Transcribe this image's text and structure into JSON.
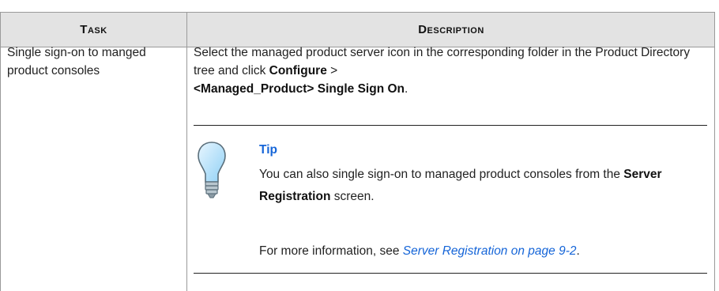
{
  "table": {
    "headers": {
      "task": "Task",
      "description": "Description"
    },
    "row": {
      "task": "Single sign-on to manged product consoles",
      "description": {
        "prefix": "Select the managed product server icon in the corresponding folder in the Product Directory tree and click ",
        "configure": "Configure",
        "separator": " > ",
        "menu_item": "<Managed_Product> Single Sign On",
        "suffix": "."
      },
      "tip": {
        "icon": "lightbulb-icon",
        "title": "Tip",
        "text_prefix": "You can also single sign-on to managed product consoles from the ",
        "text_bold": "Server Registration",
        "text_suffix": " screen.",
        "more_prefix": "For more information, see ",
        "more_link": "Server Registration on page 9-2",
        "more_suffix": "."
      }
    }
  },
  "colors": {
    "header_bg": "#e3e3e3",
    "link": "#1565d8",
    "border": "#9a9a9a"
  }
}
